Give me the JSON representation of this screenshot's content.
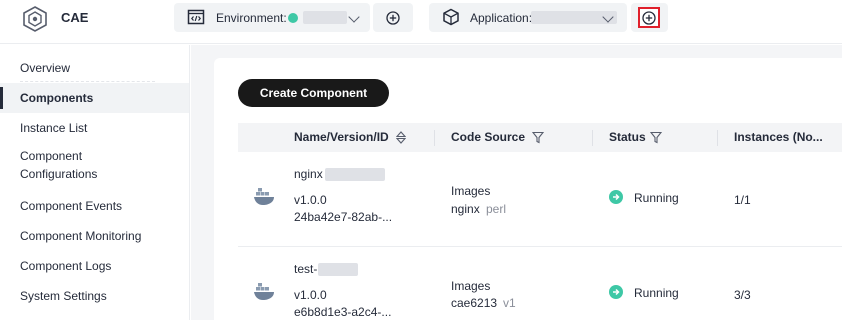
{
  "header": {
    "brand": "CAE",
    "environment_label": "Environment:",
    "application_label": "Application:"
  },
  "sidebar": {
    "items": [
      {
        "label": "Overview"
      },
      {
        "label": "Components"
      },
      {
        "label": "Instance List"
      },
      {
        "label": "Component Configurations"
      },
      {
        "label": "Component Events"
      },
      {
        "label": "Component Monitoring"
      },
      {
        "label": "Component Logs"
      },
      {
        "label": "System Settings"
      }
    ],
    "active_index": 1
  },
  "toolbar": {
    "create_label": "Create Component"
  },
  "table": {
    "columns": [
      "Name/Version/ID",
      "Code Source",
      "Status",
      "Instances (No..."
    ],
    "rows": [
      {
        "name": "nginx",
        "version": "v1.0.0",
        "id": "24ba42e7-82ab-...",
        "source_type": "Images",
        "source_name": "nginx",
        "source_tag": "perl",
        "status": "Running",
        "instances": "1/1"
      },
      {
        "name": "test-",
        "version": "v1.0.0",
        "id": "e6b8d1e3-a2c4-...",
        "source_type": "Images",
        "source_name": "cae6213",
        "source_tag": "v1",
        "status": "Running",
        "instances": "3/3"
      }
    ]
  },
  "colors": {
    "accent_dark": "#191919",
    "status_running": "#3ec8a6",
    "highlight_border": "#e0202c"
  },
  "icons": [
    "cae-logo-icon",
    "environment-code-icon",
    "add-circle-icon",
    "application-cube-icon",
    "chevron-down-icon",
    "sort-icon",
    "filter-icon",
    "docker-icon",
    "running-status-icon"
  ]
}
